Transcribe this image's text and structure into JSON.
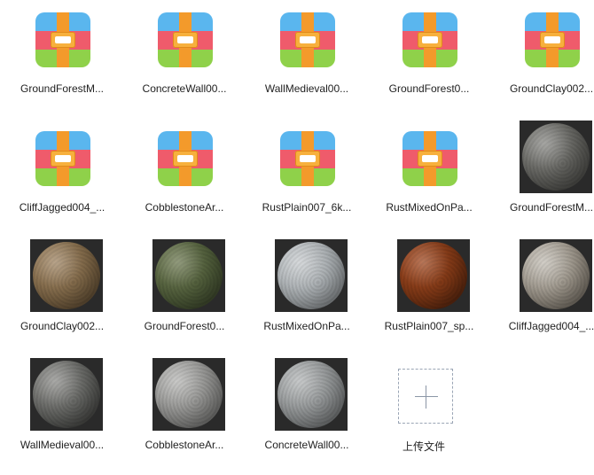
{
  "files": [
    {
      "name": "GroundForestM...",
      "kind": "archive",
      "icon": "archive-icon"
    },
    {
      "name": "ConcreteWall00...",
      "kind": "archive",
      "icon": "archive-icon"
    },
    {
      "name": "WallMedieval00...",
      "kind": "archive",
      "icon": "archive-icon"
    },
    {
      "name": "GroundForest0...",
      "kind": "archive",
      "icon": "archive-icon"
    },
    {
      "name": "GroundClay002...",
      "kind": "archive",
      "icon": "archive-icon"
    },
    {
      "name": "CliffJagged004_...",
      "kind": "archive",
      "icon": "archive-icon"
    },
    {
      "name": "CobblestoneAr...",
      "kind": "archive",
      "icon": "archive-icon"
    },
    {
      "name": "RustPlain007_6k...",
      "kind": "archive",
      "icon": "archive-icon"
    },
    {
      "name": "RustMixedOnPa...",
      "kind": "archive",
      "icon": "archive-icon"
    },
    {
      "name": "GroundForestM...",
      "kind": "material",
      "colors": [
        "#8a8a86",
        "#5e5e5a",
        "#3b3b38"
      ]
    },
    {
      "name": "GroundClay002...",
      "kind": "material",
      "colors": [
        "#a18664",
        "#7a6344",
        "#4a3a26"
      ]
    },
    {
      "name": "GroundForest0...",
      "kind": "material",
      "colors": [
        "#6e7a52",
        "#4d5a38",
        "#2e3622"
      ]
    },
    {
      "name": "RustMixedOnPa...",
      "kind": "material",
      "colors": [
        "#c9cdd0",
        "#a2a7aa",
        "#6b6e70"
      ]
    },
    {
      "name": "RustPlain007_sp...",
      "kind": "material",
      "colors": [
        "#a24a22",
        "#7a3514",
        "#3e1a0a"
      ]
    },
    {
      "name": "CliffJagged004_...",
      "kind": "material",
      "colors": [
        "#c4bfb6",
        "#948d82",
        "#5a544b"
      ]
    },
    {
      "name": "WallMedieval00...",
      "kind": "material",
      "colors": [
        "#8f8f8c",
        "#5f605d",
        "#2e2e2c"
      ]
    },
    {
      "name": "CobblestoneAr...",
      "kind": "material",
      "colors": [
        "#b8b8b6",
        "#8d8d8b",
        "#5a5a58"
      ]
    },
    {
      "name": "ConcreteWall00...",
      "kind": "material",
      "colors": [
        "#b5b8b9",
        "#8c8f90",
        "#5a5c5d"
      ]
    }
  ],
  "upload": {
    "label": "上传文件",
    "icon": "plus-icon"
  },
  "colors": {
    "label": "#222222",
    "upload_border": "#9aa5b5"
  }
}
